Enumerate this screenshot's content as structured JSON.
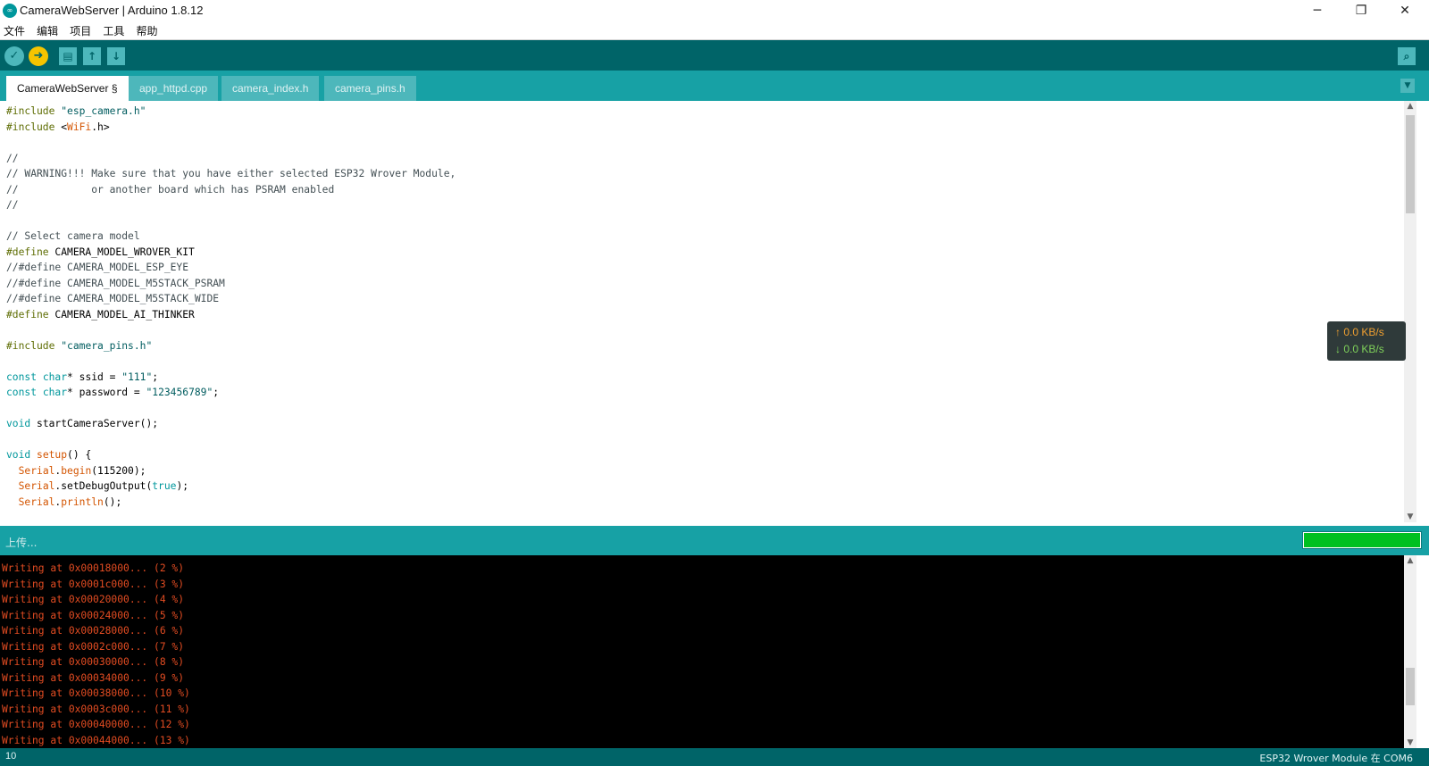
{
  "window": {
    "title": "CameraWebServer | Arduino 1.8.12",
    "icon": "arduino-logo-icon",
    "controls": {
      "minimize": "─",
      "maximize": "❐",
      "close": "✕"
    }
  },
  "menu": [
    "文件",
    "编辑",
    "项目",
    "工具",
    "帮助"
  ],
  "toolbar": {
    "verify": "✓",
    "upload": "➜",
    "new": "▤",
    "open": "↑",
    "save": "↓",
    "serial_monitor": "⌕"
  },
  "tabs": [
    "CameraWebServer §",
    "app_httpd.cpp",
    "camera_index.h",
    "camera_pins.h"
  ],
  "tab_menu_icon": "▼",
  "net_monitor": {
    "up": "↑ 0.0 KB/s",
    "down": "↓ 0.0 KB/s"
  },
  "status": {
    "text": "上传...",
    "progress": 1.0
  },
  "console_lines": [
    "Writing at 0x00018000... (2 %)",
    "Writing at 0x0001c000... (3 %)",
    "Writing at 0x00020000... (4 %)",
    "Writing at 0x00024000... (5 %)",
    "Writing at 0x00028000... (6 %)",
    "Writing at 0x0002c000... (7 %)",
    "Writing at 0x00030000... (8 %)",
    "Writing at 0x00034000... (9 %)",
    "Writing at 0x00038000... (10 %)",
    "Writing at 0x0003c000... (11 %)",
    "Writing at 0x00040000... (12 %)",
    "Writing at 0x00044000... (13 %)"
  ],
  "bottom": {
    "line": "10",
    "board": "ESP32 Wrover Module 在 COM6"
  },
  "colors": {
    "teal_dark": "#006468",
    "teal": "#17a1a5",
    "console_text": "#e34c22",
    "progress_fill": "#00c020"
  }
}
